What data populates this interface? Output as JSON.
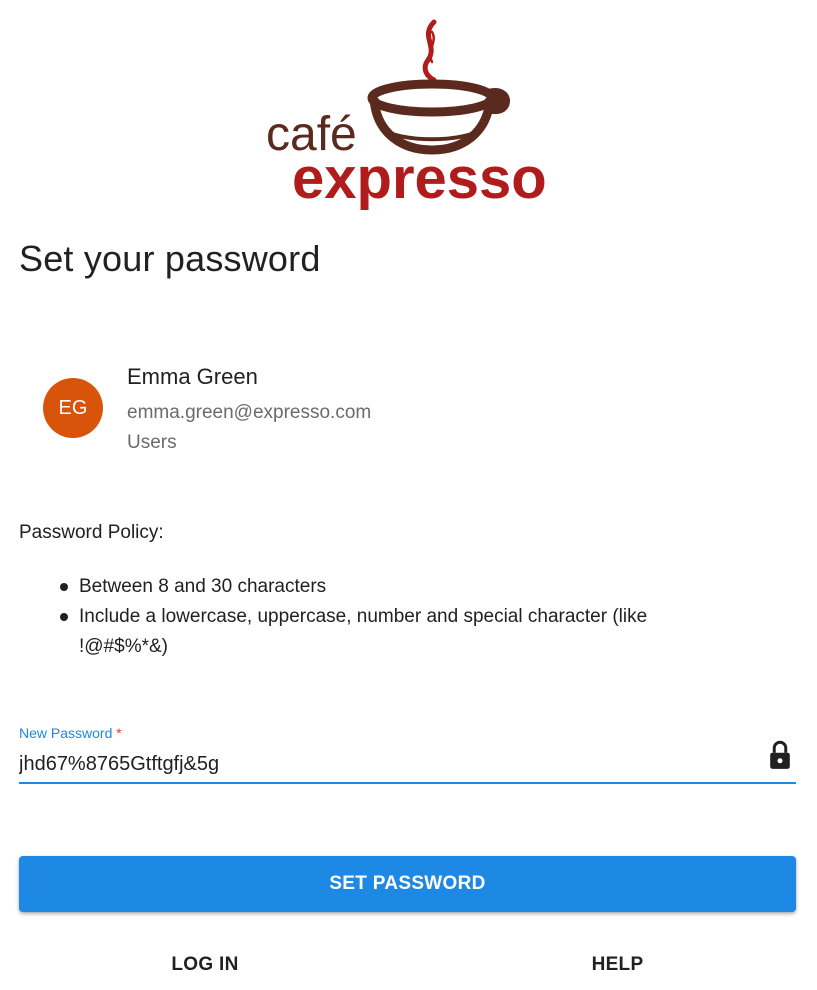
{
  "brand": {
    "logo_line1": "café",
    "logo_line2": "expresso",
    "colors": {
      "cup": "#5a2a1e",
      "steam": "#b01c1c",
      "wordmark_red": "#b01c1c",
      "wordmark_brown": "#5a2a1e"
    }
  },
  "page": {
    "title": "Set your password"
  },
  "user": {
    "initials": "EG",
    "name": "Emma Green",
    "email": "emma.green@expresso.com",
    "group": "Users",
    "avatar_color": "#d9540b"
  },
  "policy": {
    "title": "Password Policy:",
    "rules": [
      "Between 8 and 30 characters",
      "Include a lowercase, uppercase, number and special character (like !@#$%*&)"
    ]
  },
  "form": {
    "password_label": "New Password",
    "required_marker": "*",
    "password_value": "jhd67%8765Gtftgfj&5g",
    "lock_icon": "lock-icon",
    "accent_color": "#1e88e5"
  },
  "actions": {
    "submit_label": "SET PASSWORD",
    "login_label": "LOG IN",
    "help_label": "HELP"
  }
}
